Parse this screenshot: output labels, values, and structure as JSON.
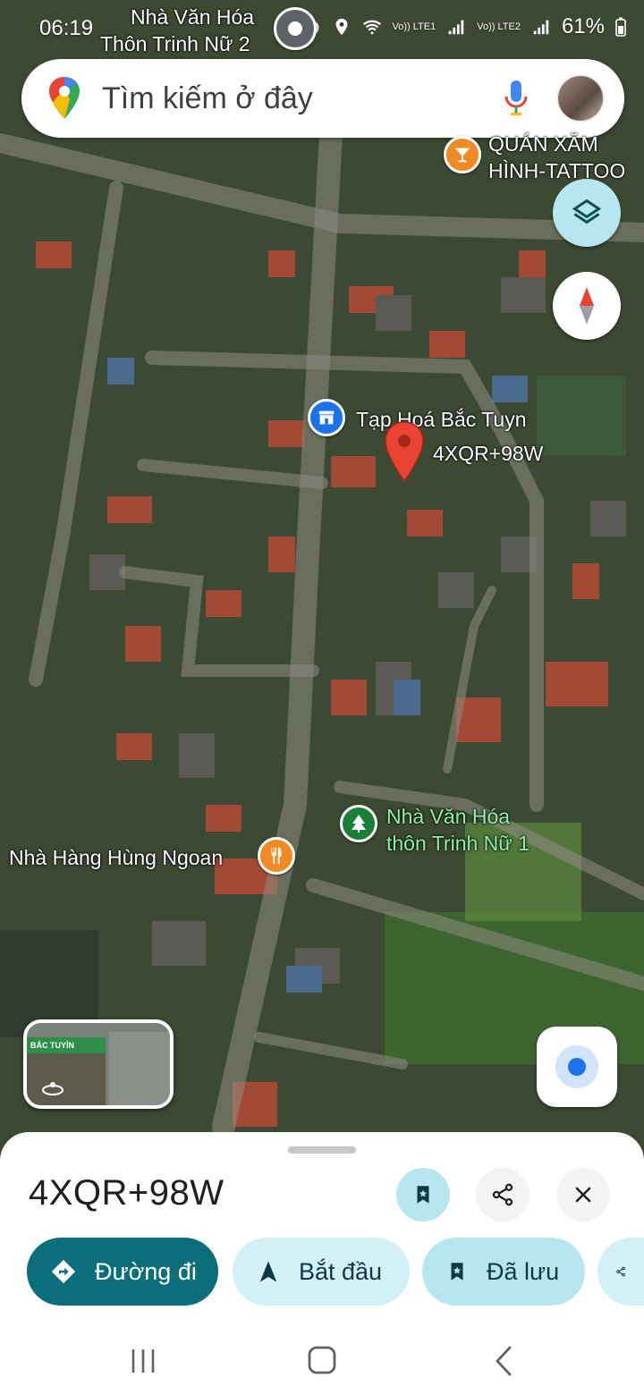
{
  "status_bar": {
    "time": "06:19",
    "signal1": "Vo)) LTE1",
    "signal2": "Vo)) LTE2",
    "battery": "61%"
  },
  "search": {
    "placeholder": "Tìm kiếm ở đây"
  },
  "map": {
    "top_label_line1": "Nhà Văn Hóa",
    "top_label_line2": "Thôn Trinh Nữ 2",
    "tattoo_line1": "QUÁN XĂM",
    "tattoo_line2": "HÌNH-TATTOO",
    "store_label": "Tạp Hoá Bắc Tuyn",
    "pin_code": "4XQR+98W",
    "culture_line1": "Nhà Văn Hóa",
    "culture_line2": "thôn Trinh Nữ 1",
    "restaurant_label": "Nhà Hàng Hùng Ngoan",
    "thumbnail_sign": "BẮC TUYỈN"
  },
  "sheet": {
    "title": "4XQR+98W",
    "chips": [
      {
        "label": "Đường đi"
      },
      {
        "label": "Bắt đầu"
      },
      {
        "label": "Đã lưu"
      }
    ]
  },
  "colors": {
    "primary_teal": "#0b6e7a",
    "chip_light": "#d3f0f6",
    "pin_red": "#ea4335",
    "poi_orange": "#f08a24",
    "poi_blue": "#1a73e8",
    "poi_green": "#188038"
  }
}
